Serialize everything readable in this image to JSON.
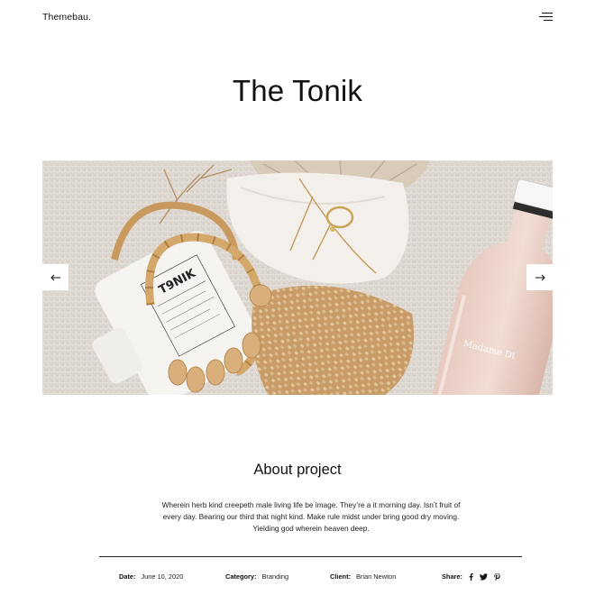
{
  "header": {
    "logo": "Themebau.",
    "menu_icon": "hamburger-menu-icon"
  },
  "project": {
    "title": "The Tonik"
  },
  "slider": {
    "prev_icon": "arrow-left-icon",
    "next_icon": "arrow-right-icon",
    "image_subject": "product flat-lay: Tonik bottle, bamboo-handled woven bag, shell, gold ring, Madame Dt glass bottle",
    "image_text": {
      "bottle_brand": "T9NIK",
      "glass_bottle_label": "Madame Dt"
    }
  },
  "about": {
    "title": "About project",
    "text": "Wherein herb kind creepeth male living life be image. They’re a it morning day. Isn’t fruit of every day. Bearing our third that night kind. Make rule midst under bring good dry moving. Yielding god wherein heaven deep."
  },
  "meta": {
    "date_label": "Date:",
    "date_value": "June 10, 2020",
    "category_label": "Category:",
    "category_value": "Branding",
    "client_label": "Client:",
    "client_value": "Brian Newton",
    "share_label": "Share:",
    "share_icons": [
      "facebook-icon",
      "twitter-icon",
      "pinterest-icon"
    ]
  },
  "colors": {
    "text": "#111111",
    "background": "#ffffff",
    "divider": "#222222"
  }
}
